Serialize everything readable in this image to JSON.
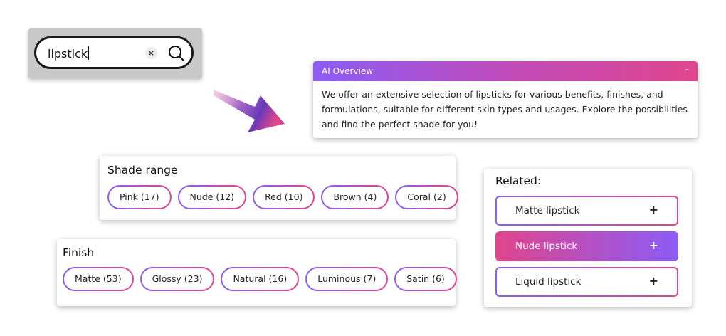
{
  "search": {
    "query": "lipstick",
    "clear_glyph": "×",
    "search_icon": "search-icon"
  },
  "ai_overview": {
    "title": "AI Overview",
    "collapse_glyph": "-",
    "body": "We offer an extensive selection of lipsticks for various benefits, finishes, and formulations, suitable for different skin types and usages. Explore the possibilities and find the perfect shade for you!"
  },
  "shade_range": {
    "title": "Shade range",
    "chips": [
      "Pink (17)",
      "Nude (12)",
      "Red (10)",
      "Brown (4)",
      "Coral (2)"
    ]
  },
  "finish": {
    "title": "Finish",
    "chips": [
      "Matte (53)",
      "Glossy (23)",
      "Natural (16)",
      "Luminous (7)",
      "Satin (6)"
    ]
  },
  "related": {
    "title": "Related:",
    "items": [
      {
        "label": "Matte lipstick",
        "action": "+"
      },
      {
        "label": "Nude lipstick",
        "action": "+"
      },
      {
        "label": "Liquid lipstick",
        "action": "+"
      }
    ]
  },
  "colors": {
    "gradient_purple": "#8b5cf6",
    "gradient_pink": "#e0458c"
  }
}
